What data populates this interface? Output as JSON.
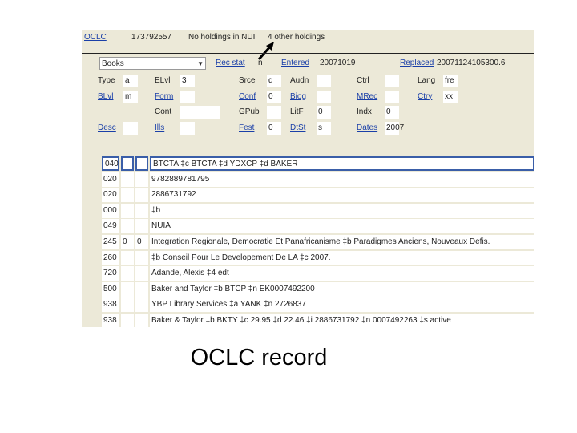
{
  "header": {
    "system": "OCLC",
    "number": "173792557",
    "holdings_nl": "No holdings in NUI",
    "other_holdings": "4 other holdings"
  },
  "format_select": "Books",
  "fixed_fields": {
    "rec_stat": {
      "label": "Rec stat",
      "value": "n"
    },
    "entered": {
      "label": "Entered",
      "value": "20071019"
    },
    "replaced": {
      "label": "Replaced",
      "value": "20071124105300.6"
    },
    "rows": [
      [
        {
          "label": "Type",
          "value": "a",
          "link": false
        },
        {
          "label": "ELvl",
          "value": "3",
          "link": false
        },
        {
          "label": "Srce",
          "value": "d",
          "link": false
        },
        {
          "label": "Audn",
          "value": "",
          "link": false
        },
        {
          "label": "Ctrl",
          "value": "",
          "link": false
        },
        {
          "label": "Lang",
          "value": "fre",
          "link": false
        }
      ],
      [
        {
          "label": "BLvl",
          "value": "m",
          "link": true
        },
        {
          "label": "Form",
          "value": "",
          "link": true
        },
        {
          "label": "Conf",
          "value": "0",
          "link": true
        },
        {
          "label": "Biog",
          "value": "",
          "link": true
        },
        {
          "label": "MRec",
          "value": "",
          "link": true
        },
        {
          "label": "Ctry",
          "value": "xx",
          "link": true
        }
      ],
      [
        null,
        {
          "label": "Cont",
          "value": "",
          "link": false
        },
        {
          "label": "GPub",
          "value": "",
          "link": false
        },
        {
          "label": "LitF",
          "value": "0",
          "link": false
        },
        {
          "label": "Indx",
          "value": "0",
          "link": false
        },
        null
      ],
      [
        {
          "label": "Desc",
          "value": "",
          "link": true
        },
        {
          "label": "Ills",
          "value": "",
          "link": true
        },
        {
          "label": "Fest",
          "value": "0",
          "link": true
        },
        {
          "label": "DtSt",
          "value": "s",
          "link": true
        },
        {
          "label": "Dates",
          "value": "2007",
          "link": true
        },
        null
      ]
    ]
  },
  "fields": [
    {
      "tag": "040",
      "i1": "",
      "i2": "",
      "text": "BTCTA ‡c BTCTA ‡d YDXCP ‡d BAKER"
    },
    {
      "tag": "020",
      "i1": "",
      "i2": "",
      "text": "9782889781795"
    },
    {
      "tag": "020",
      "i1": "",
      "i2": "",
      "text": "2886731792"
    },
    {
      "tag": "000",
      "i1": "",
      "i2": "",
      "text": "‡b"
    },
    {
      "tag": "049",
      "i1": "",
      "i2": "",
      "text": "NUIA"
    },
    {
      "tag": "245",
      "i1": "0",
      "i2": "0",
      "text": "Integration Regionale, Democratie Et Panafricanisme ‡b Paradigmes Anciens, Nouveaux Defis."
    },
    {
      "tag": "260",
      "i1": "",
      "i2": "",
      "text": "‡b Conseil Pour Le Developement De LA ‡c 2007."
    },
    {
      "tag": "720",
      "i1": "",
      "i2": "",
      "text": "Adande, Alexis ‡4 edt"
    },
    {
      "tag": "500",
      "i1": "",
      "i2": "",
      "text": "Baker and Taylor ‡b BTCP ‡n EK0007492200"
    },
    {
      "tag": "938",
      "i1": "",
      "i2": "",
      "text": "YBP Library Services ‡a YANK ‡n 2726837"
    },
    {
      "tag": "938",
      "i1": "",
      "i2": "",
      "text": "Baker & Taylor ‡b BKTY ‡c 29.95 ‡d 22.46 ‡i 2886731792 ‡n 0007492263 ‡s active"
    }
  ],
  "caption": "OCLC record"
}
